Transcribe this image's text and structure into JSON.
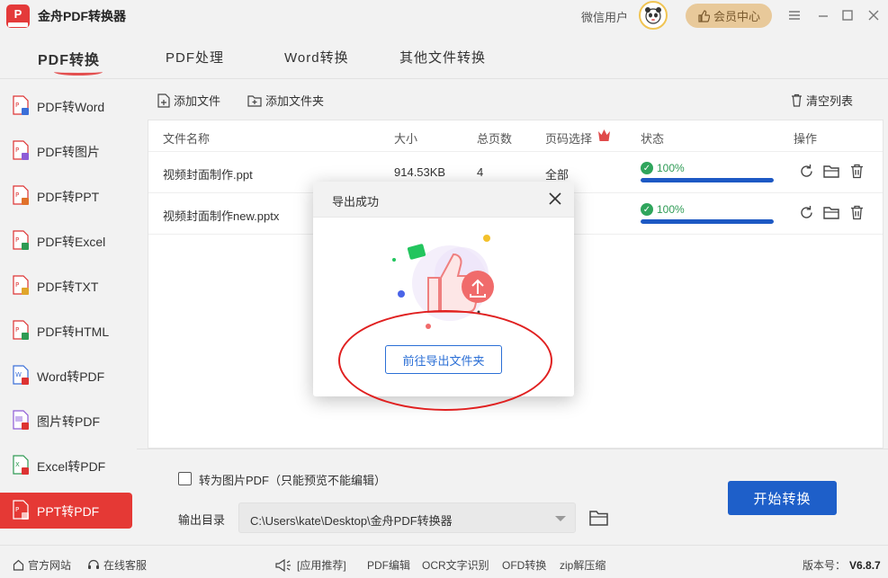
{
  "app": {
    "title": "金舟PDF转换器",
    "user": "微信用户",
    "vip_label": "会员中心"
  },
  "top_tabs": [
    {
      "label": "PDF转换",
      "active": true
    },
    {
      "label": "PDF处理"
    },
    {
      "label": "Word转换"
    },
    {
      "label": "其他文件转换"
    }
  ],
  "sidebar": {
    "items": [
      {
        "label": "PDF转Word",
        "badge_color": "#3b6fd8"
      },
      {
        "label": "PDF转图片",
        "badge_color": "#8e5bd6"
      },
      {
        "label": "PDF转PPT",
        "badge_color": "#e0712b"
      },
      {
        "label": "PDF转Excel",
        "badge_color": "#2f9a53"
      },
      {
        "label": "PDF转TXT",
        "badge_color": "#e0a52b"
      },
      {
        "label": "PDF转HTML",
        "badge_color": "#2f9a53"
      },
      {
        "label": "Word转PDF",
        "badge_color": "#3b6fd8"
      },
      {
        "label": "图片转PDF",
        "badge_color": "#8e5bd6"
      },
      {
        "label": "Excel转PDF",
        "badge_color": "#2f9a53"
      },
      {
        "label": "PPT转PDF",
        "active": true
      }
    ]
  },
  "toolbar": {
    "add_file": "添加文件",
    "add_folder": "添加文件夹",
    "clear_list": "清空列表"
  },
  "table": {
    "headers": {
      "name": "文件名称",
      "size": "大小",
      "pages": "总页数",
      "page_select": "页码选择",
      "status": "状态",
      "ops": "操作"
    },
    "rows": [
      {
        "name": "视频封面制作.ppt",
        "size": "914.53KB",
        "pages": "4",
        "page_select": "全部",
        "status": "100%",
        "progress": 1.0
      },
      {
        "name": "视频封面制作new.pptx",
        "size": "",
        "pages": "",
        "page_select": "",
        "status": "100%",
        "progress": 1.0
      }
    ]
  },
  "options": {
    "to_image_pdf": "转为图片PDF（只能预览不能编辑）",
    "output_label": "输出目录",
    "output_path": "C:\\Users\\kate\\Desktop\\金舟PDF转换器",
    "start_button": "开始转换"
  },
  "statusbar": {
    "website": "官方网站",
    "support": "在线客服",
    "recommend": "[应用推荐]",
    "links": [
      "PDF编辑",
      "OCR文字识别",
      "OFD转换",
      "zip解压缩"
    ],
    "version_label": "版本号：",
    "version": "V6.8.7"
  },
  "modal": {
    "title": "导出成功",
    "action": "前往导出文件夹"
  },
  "colors": {
    "accent_red": "#e53935",
    "primary_blue": "#1e5fc9",
    "success_green": "#2fa55c",
    "vip_gold": "#e8c99a",
    "annotation_red": "#e02020"
  }
}
